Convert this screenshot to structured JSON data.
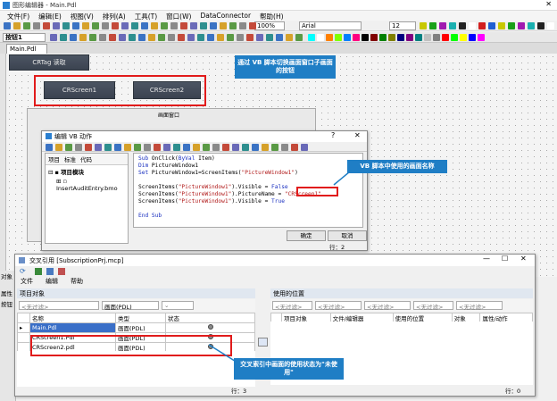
{
  "window": {
    "title": "图形编辑器 - Main.Pdl",
    "tabs": [
      "Main.Pdl"
    ]
  },
  "menu": [
    "文件(F)",
    "编辑(E)",
    "视图(V)",
    "排列(A)",
    "工具(T)",
    "窗口(W)",
    "DataConnector",
    "帮助(H)"
  ],
  "toolbar": {
    "zoom": "100%",
    "font": "Arial",
    "font_size": "12",
    "button_tab": "按钮1"
  },
  "colors": {
    "accent": "#1f7ec5",
    "highlight": "#e11b1b",
    "dark_button": "#414955"
  },
  "canvas": {
    "top_button": "CRTag 读取",
    "btn1": "CRScreen1",
    "btn2": "CRScreen2",
    "picture_window_label": "画面窗口"
  },
  "callout1": "通过 VB 脚本切换画面窗口子画面的按钮",
  "vb_dialog": {
    "title": "编辑 VB 动作",
    "tree_tabs": [
      "项目",
      "标准",
      "代码"
    ],
    "tree_root": "项目模块",
    "tree_child": "InsertAuditEntry.bmo",
    "code_lines": [
      [
        [
          "k",
          "Sub"
        ],
        [
          "n",
          " OnClick("
        ],
        [
          "k",
          "ByVal"
        ],
        [
          "n",
          " Item)"
        ]
      ],
      [
        [
          "k",
          "Dim"
        ],
        [
          "n",
          " PictureWindow1"
        ]
      ],
      [
        [
          "k",
          "Set"
        ],
        [
          "n",
          " PictureWindow1=ScreenItems("
        ],
        [
          "s",
          "\"PictureWindow1\""
        ],
        [
          "n",
          ")"
        ]
      ],
      [
        [
          "n",
          ""
        ]
      ],
      [
        [
          "n",
          "ScreenItems("
        ],
        [
          "s",
          "\"PictureWindow1\""
        ],
        [
          "n",
          ").Visible = "
        ],
        [
          "k",
          "False"
        ]
      ],
      [
        [
          "n",
          "ScreenItems("
        ],
        [
          "s",
          "\"PictureWindow1\""
        ],
        [
          "n",
          ").PictureName = "
        ],
        [
          "s",
          "\"CRScreen1\""
        ]
      ],
      [
        [
          "n",
          "ScreenItems("
        ],
        [
          "s",
          "\"PictureWindow1\""
        ],
        [
          "n",
          ").Visible = "
        ],
        [
          "k",
          "True"
        ]
      ],
      [
        [
          "n",
          ""
        ]
      ],
      [
        [
          "k",
          "End Sub"
        ]
      ]
    ],
    "ok": "确定",
    "cancel": "取消",
    "status": "行：2"
  },
  "callout2": "VB 脚本中使用的画面名称",
  "xref": {
    "title": "交叉引用 [SubscriptionPrj.mcp]",
    "menu": [
      "文件",
      "编辑",
      "帮助"
    ],
    "left_title": "项目对象",
    "right_title": "使用的位置",
    "filter_none": "<无过滤>",
    "filter_type": "画面(PDL)",
    "headers": [
      "名称",
      "类型",
      "状态"
    ],
    "rows": [
      {
        "name": "Main.Pdl",
        "type": "画面(PDL)"
      },
      {
        "name": "CRScreen1.Pdl",
        "type": "画面(PDL)"
      },
      {
        "name": "CRScreen2.pdl",
        "type": "画面(PDL)"
      }
    ],
    "right_headers": [
      "项目对象",
      "文件/编辑器",
      "使用的位置",
      "对象",
      "属性/动作"
    ],
    "left_status": "行：3",
    "right_status": "行：0"
  },
  "callout3": "交叉索引中画面的使用状态为\"未使用\"",
  "left_panel": {
    "label1": "对象",
    "label2": "属性",
    "label3": "按钮"
  }
}
